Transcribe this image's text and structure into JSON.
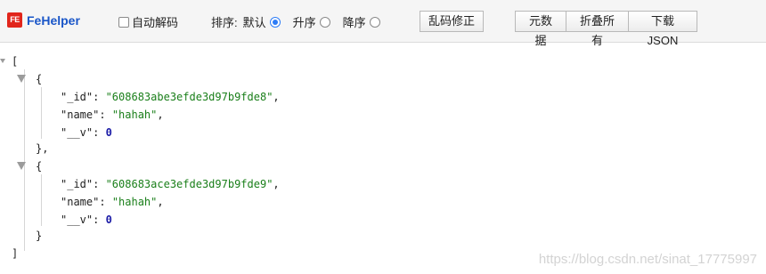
{
  "toolbar": {
    "logo_text": "FeHelper",
    "logo_badge": "FE",
    "auto_decode_label": "自动解码",
    "sort_label": "排序:",
    "sort_default": "默认",
    "sort_asc": "升序",
    "sort_desc": "降序",
    "sort_selected": "默认",
    "fix_garbled_label": "乱码修正",
    "metadata_label": "元数据",
    "collapse_all_label": "折叠所有",
    "download_json_label": "下载JSON"
  },
  "json_view": {
    "open_bracket": "[",
    "close_bracket": "]",
    "items": [
      {
        "open": "{",
        "close": "},",
        "fields": [
          {
            "key": "\"_id\"",
            "value": "\"608683abe3efde3d97b9fde8\"",
            "type": "string",
            "trail": ","
          },
          {
            "key": "\"name\"",
            "value": "\"hahah\"",
            "type": "string",
            "trail": ","
          },
          {
            "key": "\"__v\"",
            "value": "0",
            "type": "number",
            "trail": ""
          }
        ]
      },
      {
        "open": "{",
        "close": "}",
        "fields": [
          {
            "key": "\"_id\"",
            "value": "\"608683ace3efde3d97b9fde9\"",
            "type": "string",
            "trail": ","
          },
          {
            "key": "\"name\"",
            "value": "\"hahah\"",
            "type": "string",
            "trail": ","
          },
          {
            "key": "\"__v\"",
            "value": "0",
            "type": "number",
            "trail": ""
          }
        ]
      }
    ]
  },
  "watermark": "https://blog.csdn.net/sinat_17775997",
  "colors": {
    "string": "#1a7f1a",
    "number": "#1a1aa6",
    "logo_text": "#1a56c8",
    "logo_badge": "#e1251b",
    "radio_selected": "#2d7cf6"
  }
}
